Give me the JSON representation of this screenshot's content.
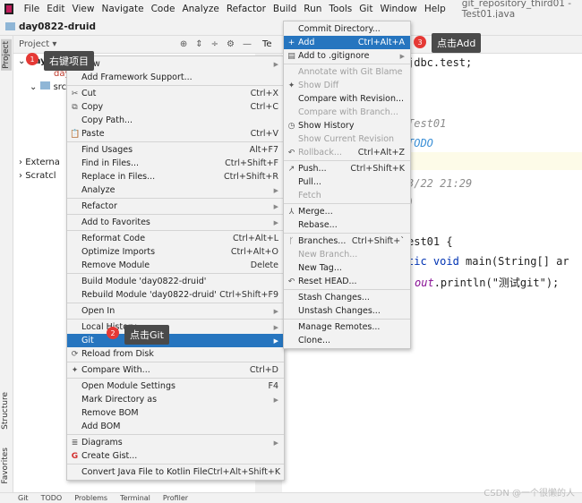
{
  "menubar": {
    "items": [
      "File",
      "Edit",
      "View",
      "Navigate",
      "Code",
      "Analyze",
      "Refactor",
      "Build",
      "Run",
      "Tools",
      "Git",
      "Window",
      "Help"
    ],
    "title": "git_repository_third01 - Test01.java"
  },
  "breadcrumb": "day0822-druid",
  "side_tabs": {
    "project": "Project",
    "structure": "Structure",
    "favorites": "Favorites"
  },
  "project_panel": {
    "title": "Project ▾",
    "tab": "Te"
  },
  "tree": {
    "root": "day0822-druid",
    "child": "day",
    "src": "src",
    "external": "Externa",
    "scratches": "Scratcl"
  },
  "context_menu": [
    {
      "label": "New",
      "arrow": true
    },
    {
      "label": "Add Framework Support..."
    },
    {
      "sep": true
    },
    {
      "label": "Cut",
      "shortcut": "Ctrl+X",
      "icon": "✂"
    },
    {
      "label": "Copy",
      "shortcut": "Ctrl+C",
      "icon": "⧉"
    },
    {
      "label": "Copy Path..."
    },
    {
      "label": "Paste",
      "shortcut": "Ctrl+V",
      "icon": "📋"
    },
    {
      "sep": true
    },
    {
      "label": "Find Usages",
      "shortcut": "Alt+F7"
    },
    {
      "label": "Find in Files...",
      "shortcut": "Ctrl+Shift+F"
    },
    {
      "label": "Replace in Files...",
      "shortcut": "Ctrl+Shift+R"
    },
    {
      "label": "Analyze",
      "arrow": true
    },
    {
      "sep": true
    },
    {
      "label": "Refactor",
      "arrow": true
    },
    {
      "sep": true
    },
    {
      "label": "Add to Favorites",
      "arrow": true
    },
    {
      "sep": true
    },
    {
      "label": "Reformat Code",
      "shortcut": "Ctrl+Alt+L"
    },
    {
      "label": "Optimize Imports",
      "shortcut": "Ctrl+Alt+O"
    },
    {
      "label": "Remove Module",
      "shortcut": "Delete"
    },
    {
      "sep": true
    },
    {
      "label": "Build Module 'day0822-druid'"
    },
    {
      "label": "Rebuild Module 'day0822-druid'",
      "shortcut": "Ctrl+Shift+F9"
    },
    {
      "sep": true
    },
    {
      "label": "Open In",
      "arrow": true
    },
    {
      "sep": true
    },
    {
      "label": "Local History",
      "arrow": true
    },
    {
      "label": "Git",
      "arrow": true,
      "selected": true
    },
    {
      "label": "Reload from Disk",
      "icon": "⟳"
    },
    {
      "sep": true
    },
    {
      "label": "Compare With...",
      "shortcut": "Ctrl+D",
      "icon": "✦"
    },
    {
      "sep": true
    },
    {
      "label": "Open Module Settings",
      "shortcut": "F4"
    },
    {
      "label": "Mark Directory as",
      "arrow": true
    },
    {
      "label": "Remove BOM"
    },
    {
      "label": "Add BOM"
    },
    {
      "sep": true
    },
    {
      "label": "Diagrams",
      "arrow": true,
      "icon": "≣"
    },
    {
      "label": "Create Gist...",
      "icon": "G"
    },
    {
      "sep": true
    },
    {
      "label": "Convert Java File to Kotlin File",
      "shortcut": "Ctrl+Alt+Shift+K"
    }
  ],
  "git_menu": [
    {
      "label": "Commit Directory..."
    },
    {
      "label": "Add",
      "shortcut": "Ctrl+Alt+A",
      "icon": "+",
      "selected": true
    },
    {
      "label": "Add to .gitignore",
      "arrow": true,
      "icon": "▤"
    },
    {
      "sep": true
    },
    {
      "label": "Annotate with Git Blame",
      "disabled": true
    },
    {
      "label": "Show Diff",
      "disabled": true,
      "icon": "✦"
    },
    {
      "label": "Compare with Revision..."
    },
    {
      "label": "Compare with Branch...",
      "disabled": true
    },
    {
      "label": "Show History",
      "icon": "◷"
    },
    {
      "label": "Show Current Revision",
      "disabled": true
    },
    {
      "label": "Rollback...",
      "shortcut": "Ctrl+Alt+Z",
      "disabled": true,
      "icon": "↶"
    },
    {
      "sep": true
    },
    {
      "label": "Push...",
      "shortcut": "Ctrl+Shift+K",
      "icon": "↗"
    },
    {
      "label": "Pull..."
    },
    {
      "label": "Fetch",
      "disabled": true
    },
    {
      "sep": true
    },
    {
      "label": "Merge...",
      "icon": "⅄"
    },
    {
      "label": "Rebase..."
    },
    {
      "sep": true
    },
    {
      "label": "Branches...",
      "shortcut": "Ctrl+Shift+`",
      "icon": "ᚴ"
    },
    {
      "label": "New Branch...",
      "disabled": true
    },
    {
      "label": "New Tag..."
    },
    {
      "label": "Reset HEAD...",
      "icon": "↶"
    },
    {
      "sep": true
    },
    {
      "label": "Stash Changes..."
    },
    {
      "label": "Unstash Changes..."
    },
    {
      "sep": true
    },
    {
      "label": "Manage Remotes..."
    },
    {
      "label": "Clone..."
    }
  ],
  "annotations": [
    {
      "num": "1",
      "text": "右键项目"
    },
    {
      "num": "2",
      "text": "点击Git"
    },
    {
      "num": "3",
      "text": "点击Add"
    }
  ],
  "code": {
    "l1": "jdbc.test;",
    "l2": "Test01",
    "l3": "TODO",
    "l4": "3/22 21:29",
    "l5": ")",
    "l6": "est01 {",
    "l7a": "tic ",
    "l7b": "void ",
    "l7c": "main(String[] ar",
    "l8a": "out",
    ".l8b": "",
    "l8c": ".println(\"测试git\");"
  },
  "bottom_tabs": [
    "Git",
    "TODO",
    "Problems",
    "Terminal",
    "Profiler"
  ],
  "watermark": "CSDN @一个很懒的人",
  "colors": {
    "accent": "#2675bf",
    "badge": "#e53935"
  }
}
